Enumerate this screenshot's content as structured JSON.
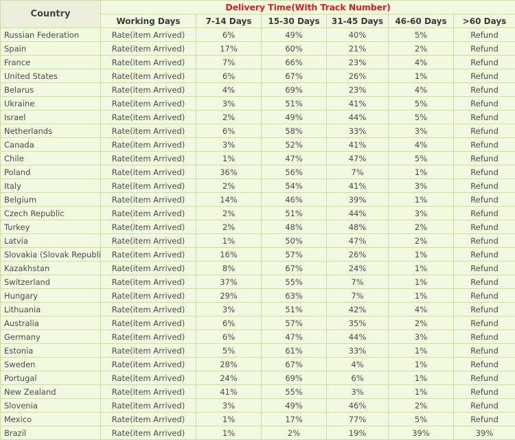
{
  "table": {
    "country_header": "Country",
    "group_header": "Delivery Time(With Track Number)",
    "colors": {
      "group_header_text": "#E01B1B",
      "cell_background": "#F3F8E0",
      "country_header_background": "#EEEEDD",
      "border": "#C9DCA4",
      "text": "#4a4a4a"
    },
    "columns": [
      "Working Days",
      "7-14 Days",
      "15-30 Days",
      "31-45 Days",
      "46-60 Days",
      ">60 Days"
    ],
    "rows": [
      {
        "country": "Russian Federation",
        "cells": [
          "Rate(item Arrived)",
          "6%",
          "49%",
          "40%",
          "5%",
          "Refund"
        ]
      },
      {
        "country": "Spain",
        "cells": [
          "Rate(item Arrived)",
          "17%",
          "60%",
          "21%",
          "2%",
          "Refund"
        ]
      },
      {
        "country": "France",
        "cells": [
          "Rate(item Arrived)",
          "7%",
          "66%",
          "23%",
          "4%",
          "Refund"
        ]
      },
      {
        "country": "United States",
        "cells": [
          "Rate(item Arrived)",
          "6%",
          "67%",
          "26%",
          "1%",
          "Refund"
        ]
      },
      {
        "country": "Belarus",
        "cells": [
          "Rate(item Arrived)",
          "4%",
          "69%",
          "23%",
          "4%",
          "Refund"
        ]
      },
      {
        "country": "Ukraine",
        "cells": [
          "Rate(item Arrived)",
          "3%",
          "51%",
          "41%",
          "5%",
          "Refund"
        ]
      },
      {
        "country": "Israel",
        "cells": [
          "Rate(item Arrived)",
          "2%",
          "49%",
          "44%",
          "5%",
          "Refund"
        ]
      },
      {
        "country": "Netherlands",
        "cells": [
          "Rate(item Arrived)",
          "6%",
          "58%",
          "33%",
          "3%",
          "Refund"
        ]
      },
      {
        "country": "Canada",
        "cells": [
          "Rate(item Arrived)",
          "3%",
          "52%",
          "41%",
          "4%",
          "Refund"
        ]
      },
      {
        "country": "Chile",
        "cells": [
          "Rate(item Arrived)",
          "1%",
          "47%",
          "47%",
          "5%",
          "Refund"
        ]
      },
      {
        "country": "Poland",
        "cells": [
          "Rate(item Arrived)",
          "36%",
          "56%",
          "7%",
          "1%",
          "Refund"
        ]
      },
      {
        "country": "Italy",
        "cells": [
          "Rate(item Arrived)",
          "2%",
          "54%",
          "41%",
          "3%",
          "Refund"
        ]
      },
      {
        "country": "Belgium",
        "cells": [
          "Rate(item Arrived)",
          "14%",
          "46%",
          "39%",
          "1%",
          "Refund"
        ]
      },
      {
        "country": "Czech Republic",
        "cells": [
          "Rate(item Arrived)",
          "2%",
          "51%",
          "44%",
          "3%",
          "Refund"
        ]
      },
      {
        "country": "Turkey",
        "cells": [
          "Rate(item Arrived)",
          "2%",
          "48%",
          "48%",
          "2%",
          "Refund"
        ]
      },
      {
        "country": "Latvia",
        "cells": [
          "Rate(item Arrived)",
          "1%",
          "50%",
          "47%",
          "2%",
          "Refund"
        ]
      },
      {
        "country": "Slovakia (Slovak Republic)",
        "cells": [
          "Rate(item Arrived)",
          "16%",
          "57%",
          "26%",
          "1%",
          "Refund"
        ]
      },
      {
        "country": "Kazakhstan",
        "cells": [
          "Rate(item Arrived)",
          "8%",
          "67%",
          "24%",
          "1%",
          "Refund"
        ]
      },
      {
        "country": "Switzerland",
        "cells": [
          "Rate(item Arrived)",
          "37%",
          "55%",
          "7%",
          "1%",
          "Refund"
        ]
      },
      {
        "country": "Hungary",
        "cells": [
          "Rate(item Arrived)",
          "29%",
          "63%",
          "7%",
          "1%",
          "Refund"
        ]
      },
      {
        "country": "Lithuania",
        "cells": [
          "Rate(item Arrived)",
          "3%",
          "51%",
          "42%",
          "4%",
          "Refund"
        ]
      },
      {
        "country": "Australia",
        "cells": [
          "Rate(item Arrived)",
          "6%",
          "57%",
          "35%",
          "2%",
          "Refund"
        ]
      },
      {
        "country": "Germany",
        "cells": [
          "Rate(item Arrived)",
          "6%",
          "47%",
          "44%",
          "3%",
          "Refund"
        ]
      },
      {
        "country": "Estonia",
        "cells": [
          "Rate(item Arrived)",
          "5%",
          "61%",
          "33%",
          "1%",
          "Refund"
        ]
      },
      {
        "country": "Sweden",
        "cells": [
          "Rate(item Arrived)",
          "28%",
          "67%",
          "4%",
          "1%",
          "Refund"
        ]
      },
      {
        "country": "Portugal",
        "cells": [
          "Rate(item Arrived)",
          "24%",
          "69%",
          "6%",
          "1%",
          "Refund"
        ]
      },
      {
        "country": "New Zealand",
        "cells": [
          "Rate(item Arrived)",
          "41%",
          "55%",
          "3%",
          "1%",
          "Refund"
        ]
      },
      {
        "country": "Slovenia",
        "cells": [
          "Rate(item Arrived)",
          "3%",
          "49%",
          "46%",
          "2%",
          "Refund"
        ]
      },
      {
        "country": "Mexico",
        "cells": [
          "Rate(item Arrived)",
          "1%",
          "17%",
          "77%",
          "5%",
          "Refund"
        ]
      },
      {
        "country": "Brazil",
        "cells": [
          "Rate(item Arrived)",
          "1%",
          "2%",
          "19%",
          "39%",
          "39%"
        ]
      }
    ]
  }
}
